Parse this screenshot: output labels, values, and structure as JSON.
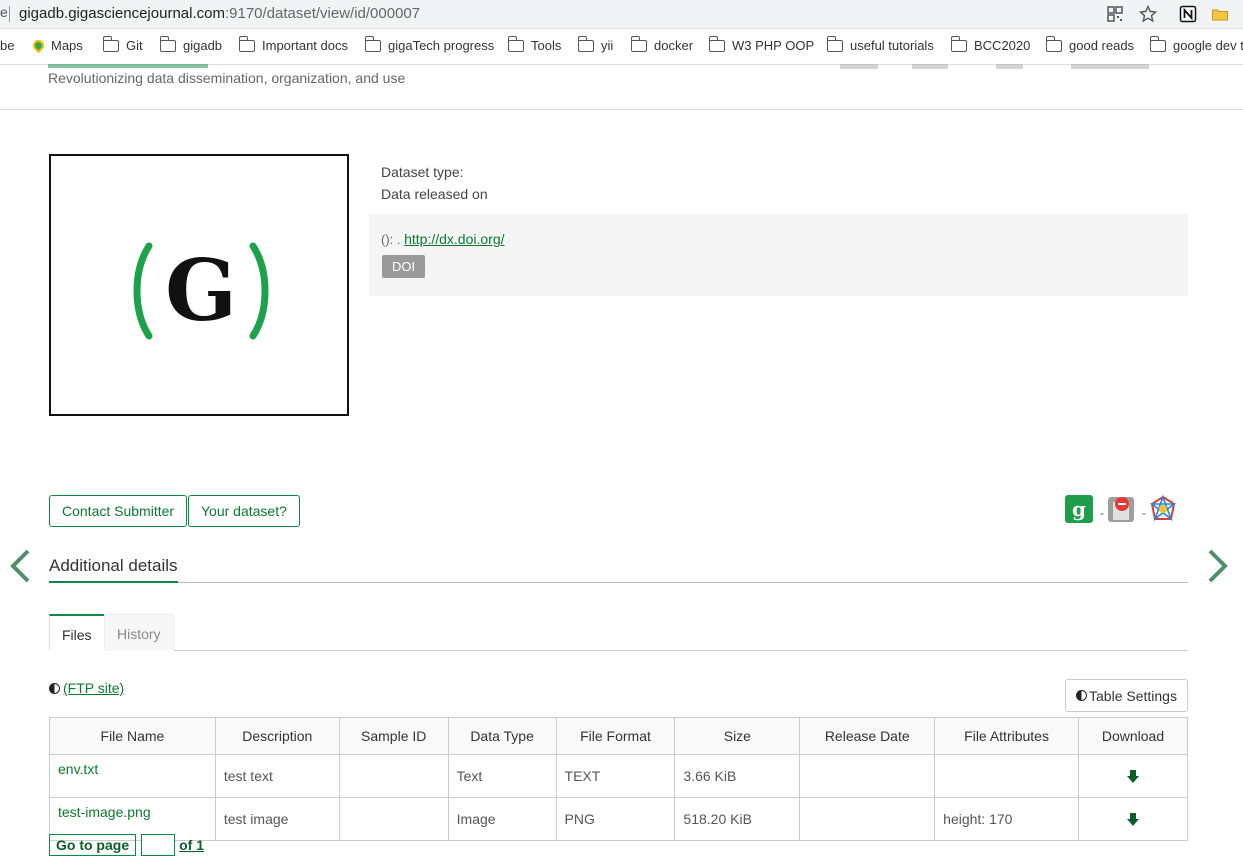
{
  "browser": {
    "url_host": "gigadb.gigasciencejournal.com",
    "url_path": ":9170/dataset/view/id/000007",
    "edge_glyph": "e",
    "bookmarks": [
      {
        "label": "be",
        "icon": "none"
      },
      {
        "label": "Maps",
        "icon": "maps-icon"
      },
      {
        "label": "Git",
        "icon": "folder-icon"
      },
      {
        "label": "gigadb",
        "icon": "folder-icon"
      },
      {
        "label": "Important docs",
        "icon": "folder-icon"
      },
      {
        "label": "gigaTech progress",
        "icon": "folder-icon"
      },
      {
        "label": "Tools",
        "icon": "folder-icon"
      },
      {
        "label": "yii",
        "icon": "folder-icon"
      },
      {
        "label": "docker",
        "icon": "folder-icon"
      },
      {
        "label": "W3 PHP OOP",
        "icon": "folder-icon"
      },
      {
        "label": "useful tutorials",
        "icon": "folder-icon"
      },
      {
        "label": "BCC2020",
        "icon": "folder-icon"
      },
      {
        "label": "good reads",
        "icon": "folder-icon"
      },
      {
        "label": "google dev t",
        "icon": "folder-icon"
      }
    ]
  },
  "header": {
    "tagline": "Revolutionizing data dissemination, organization, and use"
  },
  "dataset": {
    "dataset_type_label": "Dataset type:",
    "released_label": "Data released on",
    "doi_prefix": "(): . ",
    "doi_link": "http://dx.doi.org/",
    "doi_badge": "DOI"
  },
  "actions": {
    "contact_submitter": "Contact Submitter",
    "your_dataset": "Your dataset?",
    "share_dash_1": "-",
    "share_dash_2": "-"
  },
  "details": {
    "title": "Additional details",
    "tabs": [
      {
        "label": "Files",
        "active": true
      },
      {
        "label": "History",
        "active": false
      }
    ]
  },
  "files": {
    "ftp_label": "(FTP site)",
    "table_settings_label": "Table Settings",
    "columns": [
      "File Name",
      "Description",
      "Sample ID",
      "Data Type",
      "File Format",
      "Size",
      "Release Date",
      "File Attributes",
      "Download"
    ],
    "rows": [
      {
        "name": "env.txt",
        "description": "test text",
        "sample_id": "",
        "data_type": "Text",
        "format": "TEXT",
        "size": "3.66 KiB",
        "release_date": "",
        "attributes": ""
      },
      {
        "name": "test-image.png",
        "description": "test image",
        "sample_id": "",
        "data_type": "Image",
        "format": "PNG",
        "size": "518.20 KiB",
        "release_date": "",
        "attributes": "height: 170"
      }
    ]
  },
  "pager": {
    "goto_label": "Go to page",
    "page_value": "",
    "of_label": "of 1"
  },
  "colors": {
    "accent_green": "#0b8a46",
    "link_green": "#0b7a2f",
    "doi_badge_gray": "#9a9a9a"
  }
}
